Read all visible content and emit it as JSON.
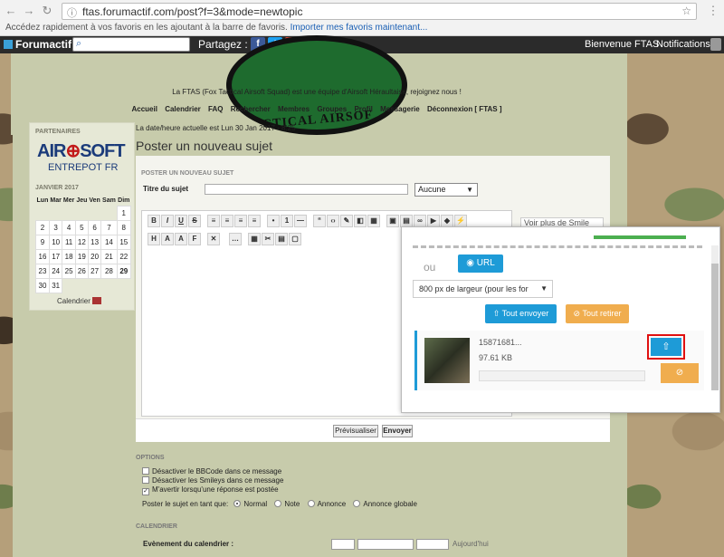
{
  "browser": {
    "url": "ftas.forumactif.com/post?f=3&mode=newtopic",
    "bookmarks_hint": "Accédez rapidement à vos favoris en les ajoutant à la barre de favoris.",
    "bookmarks_link": "Importer mes favoris maintenant..."
  },
  "toolbar": {
    "brand": "Forumactif",
    "share_label": "Partagez :",
    "welcome": "Bienvenue FTAS",
    "notifications": "Notifications"
  },
  "header": {
    "logo_text": "CTICAL AIRSOF",
    "tagline": "La FTAS (Fox Tactical Airsoft Squad) est une équipe d'Airsoft Héraultaise, rejoignez nous !",
    "menu": [
      "Accueil",
      "Calendrier",
      "FAQ",
      "Rechercher",
      "Membres",
      "Groupes",
      "Profil",
      "Messagerie",
      "Déconnexion [ FTAS ]"
    ]
  },
  "sidebar": {
    "partners_title": "PARTENAIRES",
    "airsoft_a": "AIR",
    "airsoft_b": "SOFT",
    "entrepot": "ENTREPOT FR",
    "calendar_title": "JANVIER 2017",
    "days": [
      "Lun",
      "Mar",
      "Mer",
      "Jeu",
      "Ven",
      "Sam",
      "Dim"
    ],
    "weeks": [
      [
        "",
        "",
        "",
        "",
        "",
        "",
        "1"
      ],
      [
        "2",
        "3",
        "4",
        "5",
        "6",
        "7",
        "8"
      ],
      [
        "9",
        "10",
        "11",
        "12",
        "13",
        "14",
        "15"
      ],
      [
        "16",
        "17",
        "18",
        "19",
        "20",
        "21",
        "22"
      ],
      [
        "23",
        "24",
        "25",
        "26",
        "27",
        "28",
        "29"
      ],
      [
        "30",
        "31",
        "",
        "",
        "",
        "",
        ""
      ]
    ],
    "calendar_link": "Calendrier"
  },
  "main": {
    "datetime": "La date/heure actuelle est Lun 30 Jan 2017 - 8:25",
    "page_title": "Poster un nouveau sujet",
    "form_head": "POSTER UN NOUVEAU SUJET",
    "subject_label": "Titre du sujet",
    "type_value": "Aucune",
    "smiley_more": "Voir plus de Smile",
    "preview_label": "Prévisualiser",
    "send_label": "Envoyer"
  },
  "options": {
    "title": "OPTIONS",
    "opt1": "Désactiver le BBCode dans ce message",
    "opt2": "Désactiver les Smileys dans ce message",
    "opt3": "M'avertir lorsqu'une réponse est postée",
    "post_as": "Poster le sujet en tant que:",
    "r_normal": "Normal",
    "r_note": "Note",
    "r_annonce": "Annonce",
    "r_globale": "Annonce globale",
    "calendar_title": "CALENDRIER",
    "event_label": "Evènement du calendrier :",
    "today": "Aujourd'hui"
  },
  "upload": {
    "or_label": "ou",
    "url_button": "URL",
    "size_option": "800 px de largeur (pour les for",
    "send_all": "Tout envoyer",
    "remove_all": "Tout retirer",
    "file_name": "15871681...",
    "file_size": "97.61 KB",
    "progress": 0
  }
}
